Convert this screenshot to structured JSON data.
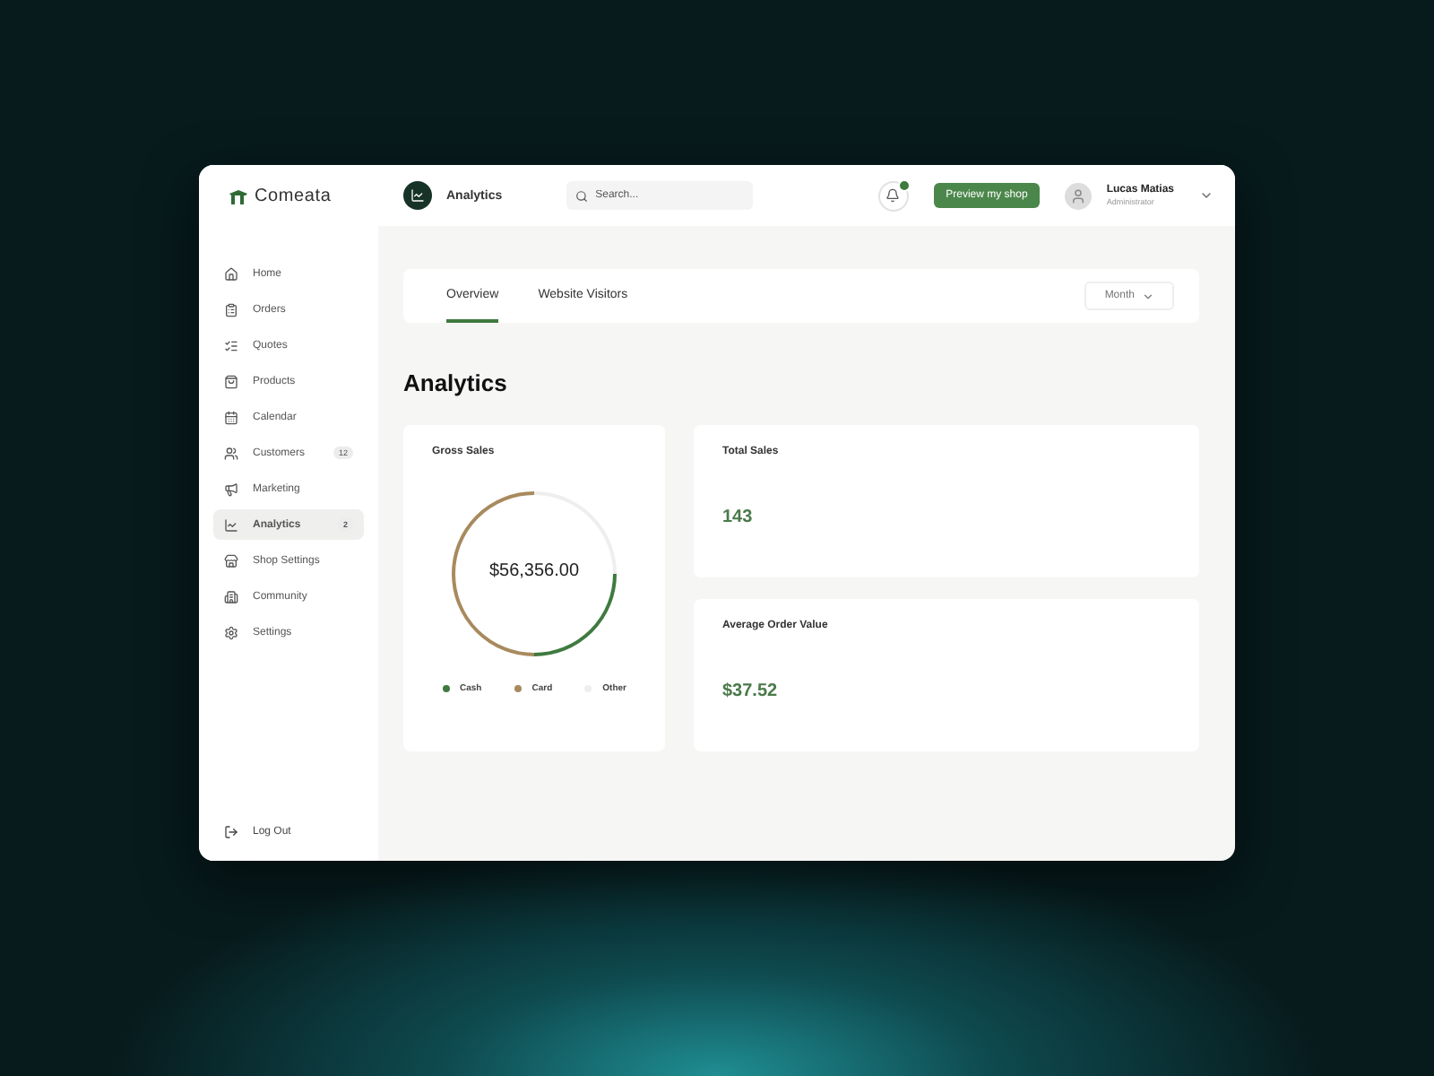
{
  "brand": {
    "name": "Comeata"
  },
  "header": {
    "page_title": "Analytics",
    "search": {
      "placeholder": "Search..."
    },
    "notifications": {
      "unread": true
    },
    "preview_button": "Preview my shop",
    "user": {
      "name": "Lucas Matias",
      "role": "Administrator"
    }
  },
  "sidebar": {
    "items": [
      {
        "label": "Home",
        "selected": false
      },
      {
        "label": "Orders",
        "selected": false
      },
      {
        "label": "Quotes",
        "selected": false
      },
      {
        "label": "Products",
        "selected": false
      },
      {
        "label": "Calendar",
        "selected": false
      },
      {
        "label": "Customers",
        "selected": false,
        "badge": "12"
      },
      {
        "label": "Marketing",
        "selected": false
      },
      {
        "label": "Analytics",
        "selected": true,
        "badge": "2"
      },
      {
        "label": "Shop Settings",
        "selected": false
      },
      {
        "label": "Community",
        "selected": false
      },
      {
        "label": "Settings",
        "selected": false
      }
    ],
    "logout": "Log Out"
  },
  "tabs": [
    {
      "label": "Overview",
      "selected": true
    },
    {
      "label": "Website Visitors",
      "selected": false
    }
  ],
  "period_select": "Month",
  "title": "Analytics",
  "gross_sales": {
    "title": "Gross Sales",
    "total": "$56,356.00",
    "legend": [
      {
        "label": "Cash",
        "color": "#3f7a3f"
      },
      {
        "label": "Card",
        "color": "#a88a5e"
      },
      {
        "label": "Other",
        "color": "#eeeeee"
      }
    ]
  },
  "stats": [
    {
      "title": "Total Sales",
      "value": "143"
    },
    {
      "title": "Average Order Value",
      "value": "$37.52"
    }
  ]
}
